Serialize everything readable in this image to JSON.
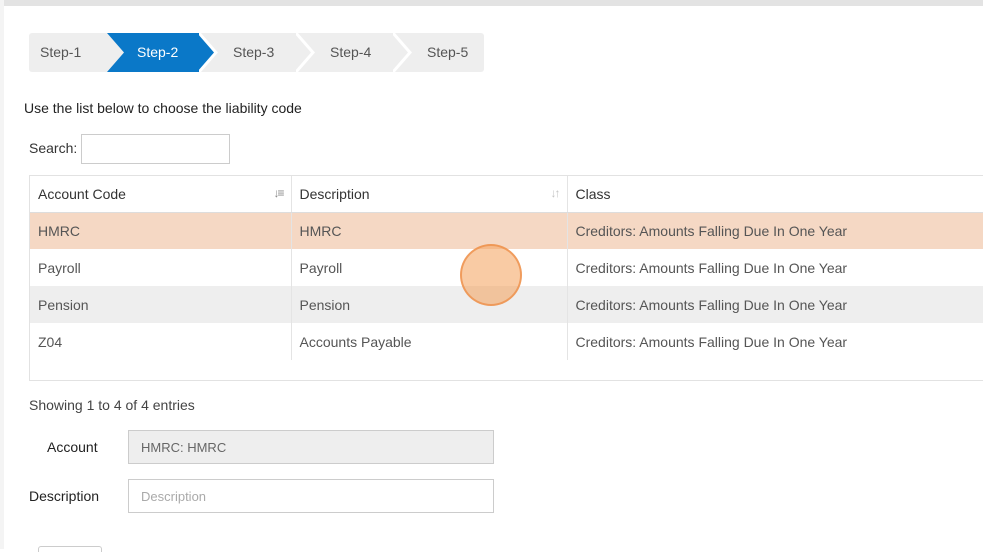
{
  "wizard": {
    "steps": [
      {
        "label": "Step-1",
        "active": false
      },
      {
        "label": "Step-2",
        "active": true
      },
      {
        "label": "Step-3",
        "active": false
      },
      {
        "label": "Step-4",
        "active": false
      },
      {
        "label": "Step-5",
        "active": false
      }
    ],
    "active_color": "#0a78c8"
  },
  "intro_text": "Use the list below to choose the liability code",
  "search": {
    "label": "Search:",
    "value": ""
  },
  "table": {
    "columns": [
      {
        "label": "Account Code",
        "sort_icon": "sort-numeric-icon"
      },
      {
        "label": "Description",
        "sort_icon": "sort-icon"
      },
      {
        "label": "Class"
      }
    ],
    "rows": [
      {
        "code": "HMRC",
        "description": "HMRC",
        "class": "Creditors: Amounts Falling Due In One Year",
        "selected": true
      },
      {
        "code": "Payroll",
        "description": "Payroll",
        "class": "Creditors: Amounts Falling Due In One Year",
        "selected": false
      },
      {
        "code": "Pension",
        "description": "Pension",
        "class": "Creditors: Amounts Falling Due In One Year",
        "selected": false
      },
      {
        "code": "Z04",
        "description": "Accounts Payable",
        "class": "Creditors: Amounts Falling Due In One Year",
        "selected": false
      }
    ],
    "selected_row_color": "#f5d8c4"
  },
  "showing_text": "Showing 1 to 4 of 4 entries",
  "form": {
    "account_label": "Account",
    "account_value": "HMRC: HMRC",
    "description_label": "Description",
    "description_placeholder": "Description"
  }
}
